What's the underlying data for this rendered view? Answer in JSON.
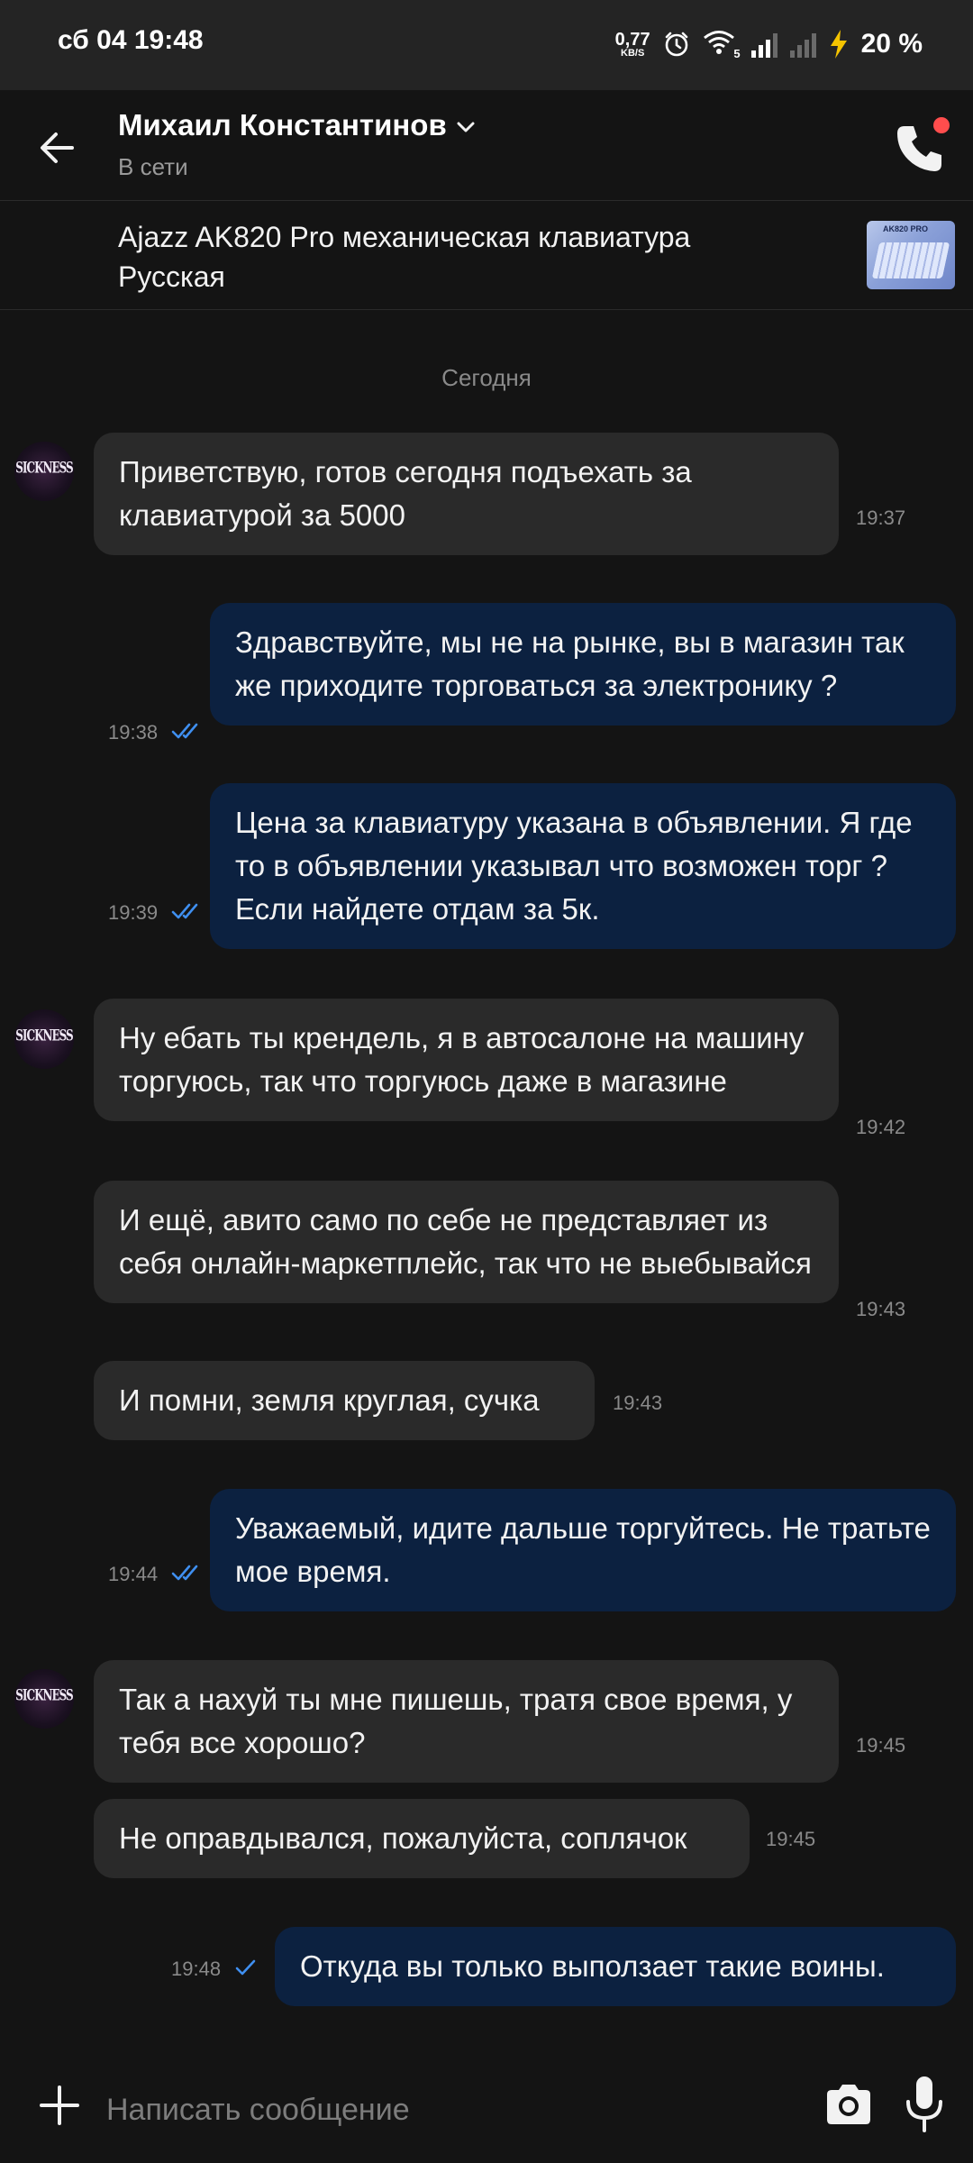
{
  "status_bar": {
    "time": "сб 04 19:48",
    "net_speed_value": "0,77",
    "net_speed_unit": "KB/S",
    "wifi_badge": "5",
    "battery_text": "20 %"
  },
  "header": {
    "contact_name": "Михаил Константинов",
    "contact_status": "В сети",
    "icons": [
      "back-arrow-icon",
      "chevron-down-icon",
      "phone-icon"
    ]
  },
  "item": {
    "title": "Ajazz AK820 Pro механическая клавиатура Русская",
    "thumb_label": "AK820 PRO"
  },
  "chat": {
    "date_separator": "Сегодня",
    "avatar_text": "SICKNESS",
    "messages": [
      {
        "direction": "in",
        "text": "Приветствую, готов сегодня подъехать за клавиатурой за 5000",
        "time": "19:37"
      },
      {
        "direction": "out",
        "text": "Здравствуйте, мы не на рынке, вы в магазин так же приходите торговаться за электронику ?",
        "time": "19:38",
        "status": "read"
      },
      {
        "direction": "out",
        "text": "Цена за клавиатуру указана в объявлении. Я где то в объявлении указывал что возможен торг ? Если найдете отдам за 5к.",
        "time": "19:39",
        "status": "read"
      },
      {
        "direction": "in",
        "text": "Ну ебать ты крендель, я в автосалоне на машину торгуюсь, так что торгуюсь даже в магазине",
        "time": "19:42"
      },
      {
        "direction": "in",
        "text": "И ещё, авито само по себе не представляет из себя онлайн-маркетплейс, так что не выебывайся",
        "time": "19:43"
      },
      {
        "direction": "in",
        "text": "И помни, земля круглая, сучка",
        "time": "19:43"
      },
      {
        "direction": "out",
        "text": "Уважаемый, идите дальше торгуйтесь. Не тратьте мое время.",
        "time": "19:44",
        "status": "read"
      },
      {
        "direction": "in",
        "text": "Так а нахуй ты мне пишешь, тратя свое время, у тебя все хорошо?",
        "time": "19:45"
      },
      {
        "direction": "in",
        "text": "Не оправдывался, пожалуйста, соплячок",
        "time": "19:45"
      },
      {
        "direction": "out",
        "text": "Откуда вы только выползает такие воины.",
        "time": "19:48",
        "status": "sent"
      }
    ]
  },
  "composer": {
    "placeholder": "Написать сообщение",
    "icons": [
      "plus-icon",
      "camera-icon",
      "microphone-icon"
    ]
  },
  "colors": {
    "background": "#141414",
    "incoming_bubble": "#2a2a2a",
    "outgoing_bubble": "#0c2140",
    "read_tick": "#3f8ff0",
    "notification_dot": "#ff4d4d"
  }
}
